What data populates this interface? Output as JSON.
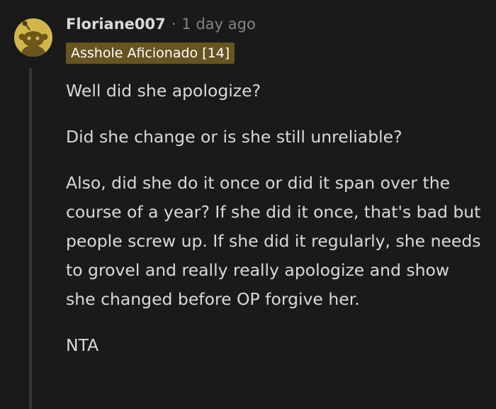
{
  "comment": {
    "username": "Floriane007",
    "separator": "·",
    "timestamp": "1 day ago",
    "flair": "Asshole Aficionado [14]",
    "avatar_icon": "reddit-snoo-avatar",
    "paragraphs": [
      "Well did she apologize?",
      "Did she change or is she still unreliable?",
      "Also, did she do it once or did it span over the course of a year? If she did it once, that's bad but people screw up. If she did it regularly, she needs to grovel and really really apologize and show she changed before OP forgive her.",
      "NTA"
    ]
  },
  "colors": {
    "background": "#1a1a1b",
    "text": "#d7dadc",
    "muted": "#818384",
    "flair_bg": "#665421",
    "avatar_bg": "#d4b54c",
    "thread_line": "#343536"
  }
}
